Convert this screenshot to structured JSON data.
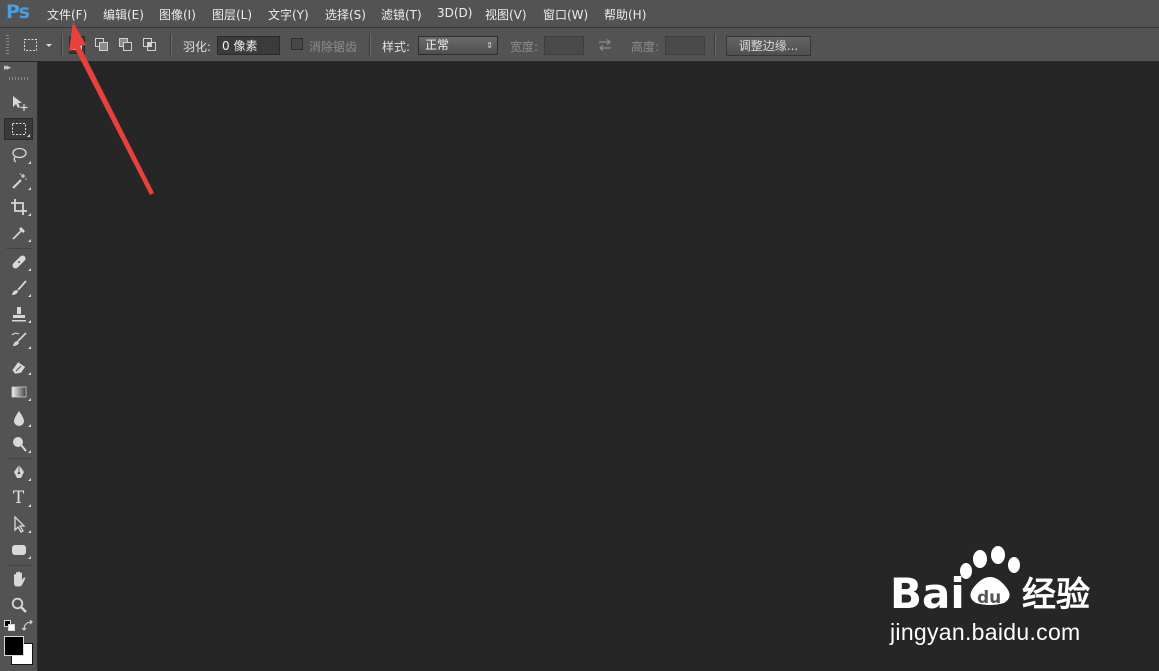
{
  "app": {
    "logo_text": "Ps"
  },
  "menubar": {
    "items": [
      {
        "label": "文件(F)"
      },
      {
        "label": "编辑(E)"
      },
      {
        "label": "图像(I)"
      },
      {
        "label": "图层(L)"
      },
      {
        "label": "文字(Y)"
      },
      {
        "label": "选择(S)"
      },
      {
        "label": "滤镜(T)"
      },
      {
        "label": "3D(D)"
      },
      {
        "label": "视图(V)"
      },
      {
        "label": "窗口(W)"
      },
      {
        "label": "帮助(H)"
      }
    ]
  },
  "options": {
    "feather_label": "羽化:",
    "feather_value": "0 像素",
    "antialias_label": "消除锯齿",
    "style_label": "样式:",
    "style_value": "正常",
    "width_label": "宽度:",
    "height_label": "高度:",
    "refine_edge_label": "调整边缘..."
  },
  "tools": [
    {
      "name": "move-tool",
      "icon": "move-icon"
    },
    {
      "name": "marquee-tool",
      "icon": "rect-marquee-icon",
      "active": true
    },
    {
      "name": "lasso-tool",
      "icon": "lasso-icon"
    },
    {
      "name": "magic-wand-tool",
      "icon": "magic-wand-icon"
    },
    {
      "name": "crop-tool",
      "icon": "crop-icon"
    },
    {
      "name": "eyedropper-tool",
      "icon": "eyedropper-icon"
    },
    {
      "name": "healing-brush-tool",
      "icon": "bandage-icon"
    },
    {
      "name": "brush-tool",
      "icon": "brush-icon"
    },
    {
      "name": "clone-stamp-tool",
      "icon": "stamp-icon"
    },
    {
      "name": "history-brush-tool",
      "icon": "history-brush-icon"
    },
    {
      "name": "eraser-tool",
      "icon": "eraser-icon"
    },
    {
      "name": "gradient-tool",
      "icon": "gradient-icon"
    },
    {
      "name": "blur-tool",
      "icon": "drop-icon"
    },
    {
      "name": "dodge-tool",
      "icon": "dodge-icon"
    },
    {
      "name": "pen-tool",
      "icon": "pen-icon"
    },
    {
      "name": "type-tool",
      "icon": "type-icon"
    },
    {
      "name": "path-selection-tool",
      "icon": "path-select-icon"
    },
    {
      "name": "shape-tool",
      "icon": "rounded-rect-icon"
    },
    {
      "name": "hand-tool",
      "icon": "hand-icon"
    },
    {
      "name": "zoom-tool",
      "icon": "zoom-icon"
    }
  ],
  "type_tool_glyph": "T",
  "watermark": {
    "brand": "Bai",
    "brand_du": "du",
    "suffix": "经验",
    "url": "jingyan.baidu.com"
  },
  "colors": {
    "annotation_arrow": "#e8403a",
    "watermark": "#ffffff",
    "logo": "#4c9de0"
  }
}
